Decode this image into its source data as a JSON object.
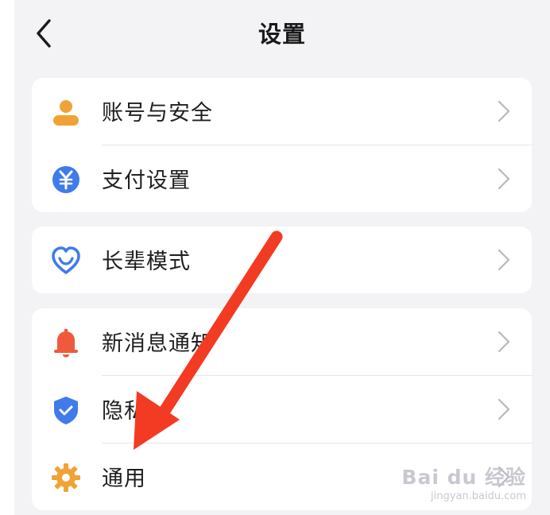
{
  "header": {
    "title": "设置",
    "back_icon": "chevron-left-icon"
  },
  "colors": {
    "background": "#f3f3f5",
    "card": "#ffffff",
    "account_icon": "#f0a236",
    "payment_icon": "#3f7bea",
    "elder_icon": "#3f7bea",
    "notification_icon": "#ef5a3c",
    "privacy_icon": "#3f7bea",
    "general_icon": "#f0a236",
    "annotation_arrow": "#f23b22",
    "chevron": "#b8b8bc"
  },
  "groups": [
    {
      "items": [
        {
          "label": "账号与安全",
          "icon": "person-icon"
        },
        {
          "label": "支付设置",
          "icon": "yuan-coin-icon"
        }
      ]
    },
    {
      "items": [
        {
          "label": "长辈模式",
          "icon": "heart-icon"
        }
      ]
    },
    {
      "items": [
        {
          "label": "新消息通知",
          "icon": "bell-icon"
        },
        {
          "label": "隐私",
          "icon": "shield-icon"
        },
        {
          "label": "通用",
          "icon": "gear-icon"
        }
      ]
    }
  ],
  "watermark": {
    "main": "Bai du 经验",
    "sub": "jingyan.baidu.com"
  }
}
